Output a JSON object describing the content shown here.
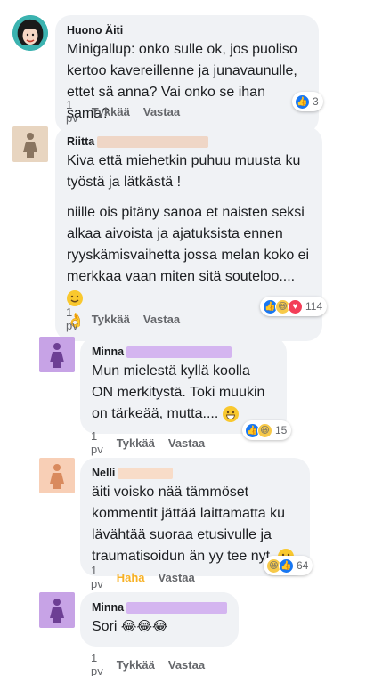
{
  "comments": [
    {
      "author": "Huono Äiti",
      "text": "Minigallup: onko sulle ok, jos puoliso kertoo kavereillenne ja junavaunulle, ettet sä anna? Vai onko se ihan sama?",
      "time": "1 pv",
      "like": "Tykkää",
      "reply": "Vastaa",
      "reaction_count": "3"
    },
    {
      "author": "Riitta",
      "text1": "Kiva että miehetkin puhuu muusta ku työstä ja lätkästä !",
      "text2": "niille ois pitäny sanoa et naisten seksi alkaa aivoista ja ajatuksista ennen ryyskämisvaihetta jossa melan koko ei merkkaa vaan miten sitä souteloo....",
      "time": "1 pv",
      "like": "Tykkää",
      "reply": "Vastaa",
      "reaction_count": "114"
    },
    {
      "author": "Minna",
      "text": "Mun mielestä kyllä koolla ON merkitystä. Toki muukin on tärkeää, mutta....",
      "time": "1 pv",
      "like": "Tykkää",
      "reply": "Vastaa",
      "reaction_count": "15"
    },
    {
      "author": "Nelli",
      "text": "äiti voisko nää tämmöset kommentit jättää laittamatta ku lävähtää suoraa etusivulle ja traumatisoidun än yy tee nyt.",
      "time": "1 pv",
      "like": "Haha",
      "reply": "Vastaa",
      "reaction_count": "64"
    },
    {
      "author": "Minna",
      "text": "Sori",
      "time": "1 pv",
      "like": "Tykkää",
      "reply": "Vastaa"
    }
  ],
  "colors": {
    "bubble": "#f0f2f5",
    "secondary_text": "#65676b",
    "like_blue": "#1877f2",
    "haha_yellow": "#f7b125",
    "redact_tan": "#efd6c6",
    "redact_purple": "#d4b5f0",
    "avatar_tan": "#e8d5c0",
    "avatar_purple": "#c7a3e6",
    "avatar_peach": "#f8cfb6"
  }
}
